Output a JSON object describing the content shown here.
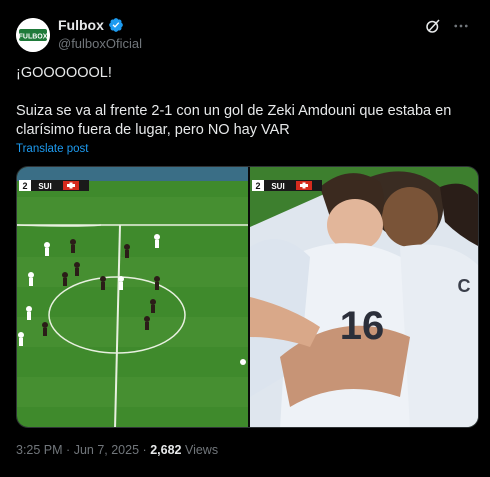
{
  "author": {
    "display_name": "Fulbox",
    "handle": "@fulboxOficial",
    "avatar_text": "FULBOX",
    "verified_icon": "verified-badge-icon",
    "brand_color": "#1d9bf0"
  },
  "post": {
    "line1": "¡GOOOOOOL!",
    "line2": "Suiza se va al frente 2-1 con un gol de Zeki Amdouni que estaba en clarísimo fuera de lugar, pero NO hay VAR",
    "translate_label": "Translate post"
  },
  "media": {
    "left_score": {
      "home_score": "2",
      "team": "SUI"
    },
    "right_score": {
      "home_score": "2",
      "team": "SUI"
    },
    "shirt_number": "16",
    "shirt_letter": "C"
  },
  "meta": {
    "time": "3:25 PM",
    "separator": "·",
    "date": "Jun 7, 2025",
    "views_count": "2,682",
    "views_label": "Views"
  }
}
